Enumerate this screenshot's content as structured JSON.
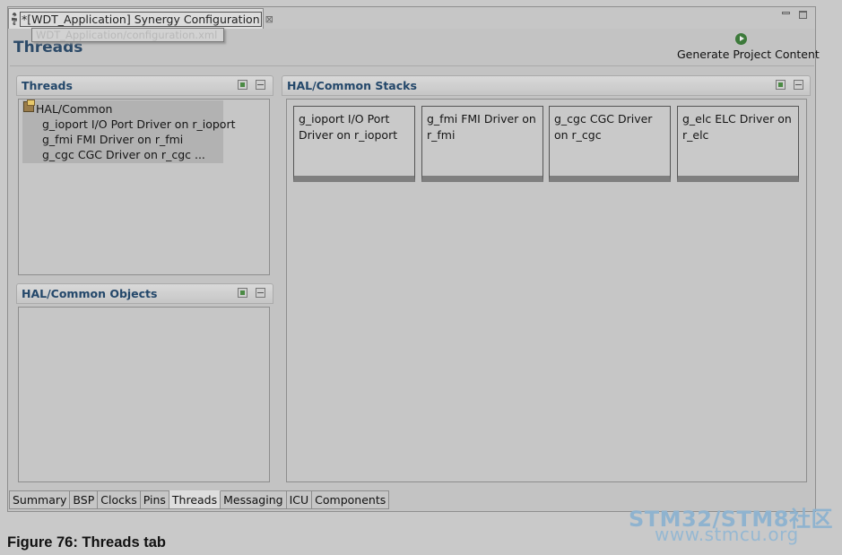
{
  "editor_tab": {
    "title": "*[WDT_Application] Synergy Configuration",
    "close_glyph": "⊠",
    "icon": "gear-icon"
  },
  "tooltip": "WDT_Application/configuration.xml",
  "page_title": "Threads",
  "generate_button": {
    "label": "Generate Project Content",
    "icon": "run-icon"
  },
  "threads_panel": {
    "title": "Threads",
    "tree": {
      "root": "HAL/Common",
      "items": [
        "g_ioport I/O Port Driver on r_ioport",
        "g_fmi FMI Driver on r_fmi",
        "g_cgc CGC Driver on r_cgc ..."
      ]
    }
  },
  "objects_panel": {
    "title": "HAL/Common Objects"
  },
  "stacks_panel": {
    "title": "HAL/Common Stacks",
    "cards": [
      "g_ioport I/O Port Driver on r_ioport",
      "g_fmi FMI Driver on r_fmi",
      "g_cgc CGC Driver on r_cgc",
      "g_elc ELC Driver on r_elc"
    ]
  },
  "bottom_tabs": [
    "Summary",
    "BSP",
    "Clocks",
    "Pins",
    "Threads",
    "Messaging",
    "ICU",
    "Components"
  ],
  "active_tab": "Threads",
  "watermark": {
    "line1": "STM32/STM8社区",
    "line2": "www.stmcu.org"
  },
  "caption": "Figure 76:  Threads tab",
  "colors": {
    "title_blue": "#2c4a68",
    "panel_title_blue": "#23476a",
    "selection_gray": "#b2b2b2",
    "watermark_blue": "#8fb3cf"
  }
}
